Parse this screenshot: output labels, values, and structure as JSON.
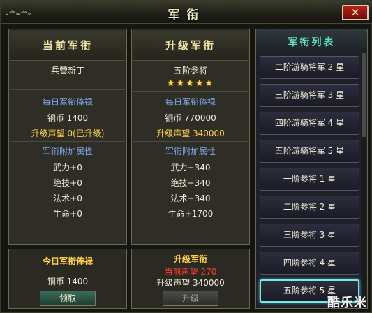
{
  "window": {
    "title": "军衔",
    "close_label": "✕"
  },
  "current": {
    "header": "当前军衔",
    "rank": "兵营新丁",
    "daily_label": "每日军衔俸禄",
    "copper": "铜币  1400",
    "upgrade_fame": "升级声望 0(已升级)",
    "attr_label": "军衔附加属性",
    "attrs": [
      "武力+0",
      "绝技+0",
      "法术+0",
      "生命+0"
    ]
  },
  "upgrade": {
    "header": "升级军衔",
    "rank": "五阶参将",
    "stars": "★★★★★",
    "daily_label": "每日军衔俸禄",
    "copper": "铜币  770000",
    "upgrade_fame": "升级声望 340000",
    "attr_label": "军衔附加属性",
    "attrs": [
      "武力+340",
      "绝技+340",
      "法术+340",
      "生命+1700"
    ]
  },
  "today_box": {
    "label": "今日军衔俸禄",
    "copper": "铜币    1400",
    "button": "领取"
  },
  "upgrade_box": {
    "label": "升级军衔",
    "current_fame": "当前声望  270",
    "required_fame": "升级声望   340000",
    "button": "升级"
  },
  "rank_list": {
    "header": "军衔列表",
    "items": [
      "二阶游骑将军 2 星",
      "三阶游骑将军 3 星",
      "四阶游骑将军 4 星",
      "五阶游骑将军 5 星",
      "一阶参将 1 星",
      "二阶参将 2 星",
      "三阶参将 3 星",
      "四阶参将 4 星",
      "五阶参将 5 星"
    ],
    "selected_index": 8
  },
  "watermark": "酷乐米"
}
